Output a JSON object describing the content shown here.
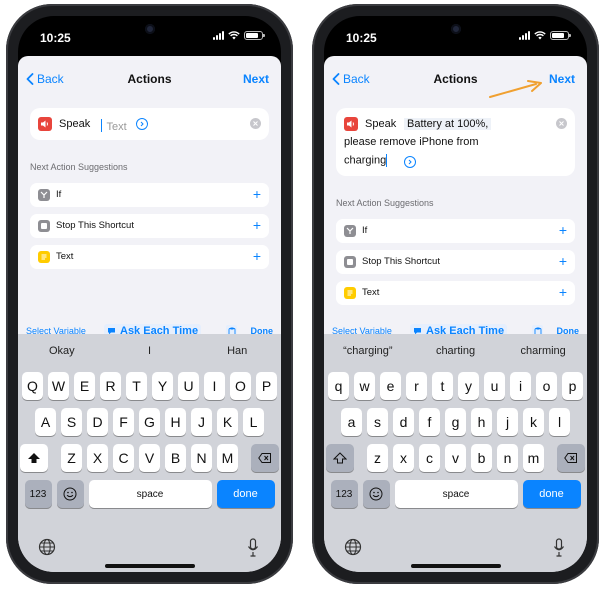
{
  "phones": [
    {
      "time": "10:25",
      "nav": {
        "back": "Back",
        "title": "Actions",
        "next": "Next"
      },
      "speak": {
        "label": "Speak",
        "placeholder": "Text",
        "text": ""
      },
      "suggestions_title": "Next Action Suggestions",
      "suggestions": [
        {
          "label": "If",
          "icon": "if-icon",
          "color": "#8e8e93"
        },
        {
          "label": "Stop This Shortcut",
          "icon": "stop-icon",
          "color": "#8e8e93"
        },
        {
          "label": "Text",
          "icon": "text-icon",
          "color": "#ffcc00"
        }
      ],
      "toolbar": {
        "select_variable": "Select Variable",
        "ask_each_time": "Ask Each Time",
        "done": "Done"
      },
      "predictions": [
        "Okay",
        "I",
        "Han"
      ],
      "keys": {
        "row1": [
          "Q",
          "W",
          "E",
          "R",
          "T",
          "Y",
          "U",
          "I",
          "O",
          "P"
        ],
        "row2": [
          "A",
          "S",
          "D",
          "F",
          "G",
          "H",
          "J",
          "K",
          "L"
        ],
        "row3": [
          "Z",
          "X",
          "C",
          "V",
          "B",
          "N",
          "M"
        ],
        "num": "123",
        "space": "space",
        "done": "done"
      },
      "shift_active": true
    },
    {
      "time": "10:25",
      "nav": {
        "back": "Back",
        "title": "Actions",
        "next": "Next"
      },
      "speak": {
        "label": "Speak",
        "text_line1": "Battery at 100%,",
        "text_line2": "please remove iPhone from",
        "text_line3": "charging"
      },
      "suggestions_title": "Next Action Suggestions",
      "suggestions": [
        {
          "label": "If",
          "icon": "if-icon",
          "color": "#8e8e93"
        },
        {
          "label": "Stop This Shortcut",
          "icon": "stop-icon",
          "color": "#8e8e93"
        },
        {
          "label": "Text",
          "icon": "text-icon",
          "color": "#ffcc00"
        }
      ],
      "toolbar": {
        "select_variable": "Select Variable",
        "ask_each_time": "Ask Each Time",
        "done": "Done"
      },
      "predictions": [
        "“charging”",
        "charting",
        "charming"
      ],
      "keys": {
        "row1": [
          "q",
          "w",
          "e",
          "r",
          "t",
          "y",
          "u",
          "i",
          "o",
          "p"
        ],
        "row2": [
          "a",
          "s",
          "d",
          "f",
          "g",
          "h",
          "j",
          "k",
          "l"
        ],
        "row3": [
          "z",
          "x",
          "c",
          "v",
          "b",
          "n",
          "m"
        ],
        "num": "123",
        "space": "space",
        "done": "done"
      },
      "shift_active": false
    }
  ],
  "annotation": {
    "arrow_color": "#f0a030",
    "points_to": "Next"
  }
}
